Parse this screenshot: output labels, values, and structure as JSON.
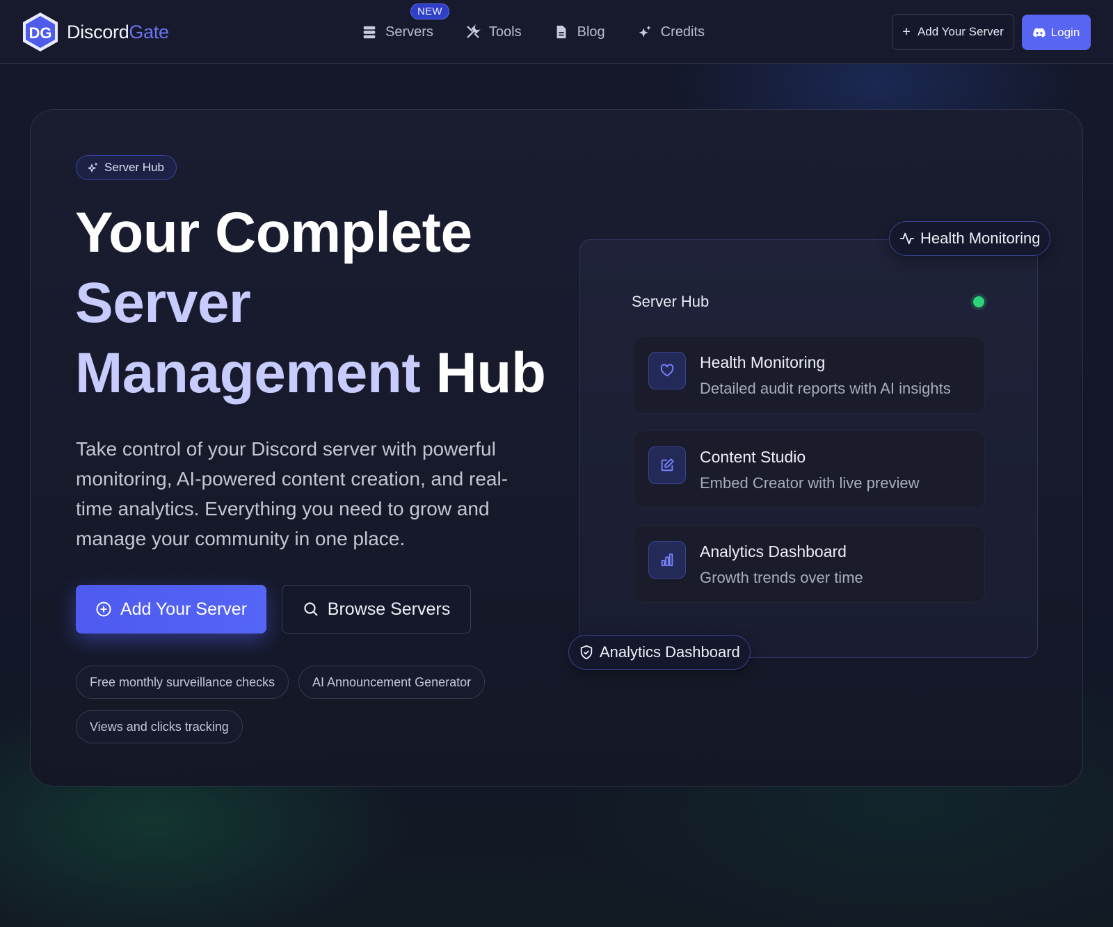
{
  "brand": {
    "name_part1": "Discord",
    "name_part2": "Gate",
    "logo_letters": "DG"
  },
  "nav": {
    "links": [
      {
        "label": "Servers",
        "icon": "server-icon",
        "badge": "NEW"
      },
      {
        "label": "Tools",
        "icon": "tools-icon"
      },
      {
        "label": "Blog",
        "icon": "document-icon"
      },
      {
        "label": "Credits",
        "icon": "sparkles-icon"
      }
    ],
    "add_server_label": "Add Your Server",
    "login_label": "Login"
  },
  "hero": {
    "pill_label": "Server Hub",
    "headline_line1": "Your Complete",
    "headline_line2": "Server",
    "headline_line3a": "Management",
    "headline_line3b": "Hub",
    "lead": "Take control of your Discord server with powerful monitoring, AI-powered content creation, and real-time analytics. Everything you need to grow and manage your community in one place.",
    "primary_button": "Add Your Server",
    "secondary_button": "Browse Servers",
    "tags": [
      "Free monthly surveillance checks",
      "AI Announcement Generator",
      "Views and clicks tracking"
    ]
  },
  "panel": {
    "title": "Server Hub",
    "status_color": "#2ed47a",
    "features": [
      {
        "title": "Health Monitoring",
        "desc": "Detailed audit reports with AI insights",
        "icon": "heart-icon"
      },
      {
        "title": "Content Studio",
        "desc": "Embed Creator with live preview",
        "icon": "edit-icon"
      },
      {
        "title": "Analytics Dashboard",
        "desc": "Growth trends over time",
        "icon": "bar-chart-icon"
      }
    ],
    "badge_top": "Health Monitoring",
    "badge_bottom": "Analytics Dashboard"
  },
  "colors": {
    "accent": "#5865f2",
    "accent_text": "#6b74f0",
    "headline_gradient": "#c7cbfd"
  }
}
